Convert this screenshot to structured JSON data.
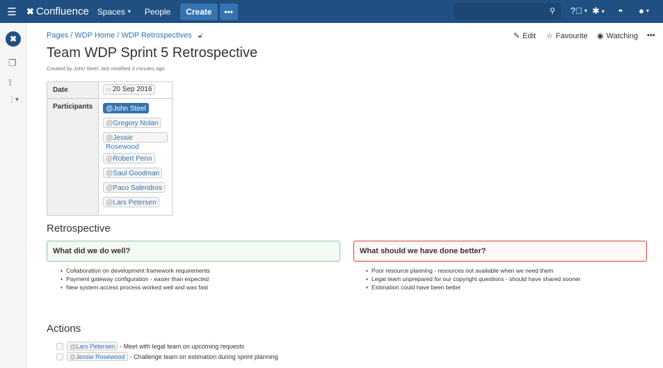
{
  "topbar": {
    "brand": "Confluence",
    "nav": [
      "Spaces",
      "People"
    ],
    "create_label": "Create",
    "more_label": "•••"
  },
  "breadcrumb": [
    "Pages",
    "WDP Home",
    "WDP Retrospectives"
  ],
  "page_actions": {
    "edit": "Edit",
    "favourite": "Favourite",
    "watching": "Watching",
    "more": "•••"
  },
  "page": {
    "title": "Team WDP Sprint 5 Retrospective",
    "byline": "Created by John Steel, last modified 3 minutes ago"
  },
  "meta_table": {
    "date_label": "Date",
    "date_value": "20 Sep 2016",
    "participants_label": "Participants",
    "participants": [
      "John Steel",
      "Gregory Nolan",
      "Jessie Rosewood",
      "Robert Penn",
      "Saul Goodman",
      "Paco Salendros",
      "Lars Petersen"
    ]
  },
  "retrospective": {
    "heading": "Retrospective",
    "good_title": "What did we do well?",
    "good_items": [
      "Collaboration on development framework requirements",
      "Payment gateway configuration - easier than expected",
      "New system access process worked well and was fast"
    ],
    "bad_title": "What should we have done better?",
    "bad_items": [
      "Poor resource planning - resources not available when we need them",
      "Legal team unprepared for our copyright questions - should have shared sooner",
      "Estimation could have been better"
    ]
  },
  "actions": {
    "heading": "Actions",
    "tasks": [
      {
        "assignee": "Lars Petersen",
        "text": " - Meet with legal team on upcoming requests"
      },
      {
        "assignee": "Jessie Rosewood",
        "text": " - Challenge team on estimation during sprint planning"
      }
    ]
  },
  "colors": {
    "header": "#205081",
    "link": "#3572b0",
    "good_border": "#91c89c",
    "bad_border": "#d04437"
  }
}
